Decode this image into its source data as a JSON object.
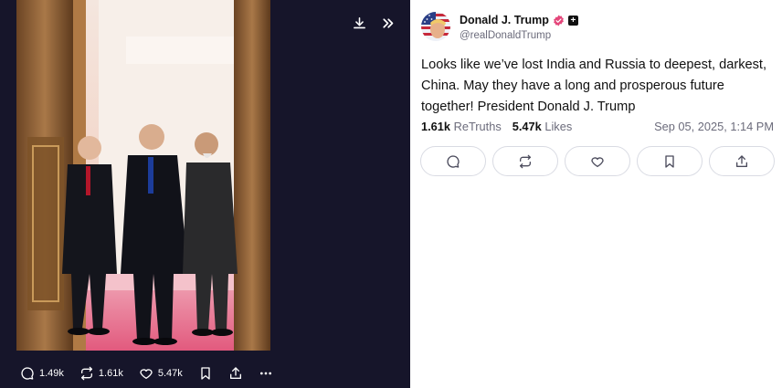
{
  "media": {
    "download_icon": "download-icon",
    "expand_icon": "chevrons-right-icon",
    "actions": {
      "replies_count": "1.49k",
      "retruths_count": "1.61k",
      "likes_count": "5.47k"
    }
  },
  "post": {
    "author_name": "Donald J. Trump",
    "author_handle": "@realDonaldTrump",
    "text": "Looks like we’ve lost India and Russia to deepest, darkest, China. May they have a long and prosperous future together! President Donald J. Trump",
    "retruths_value": "1.61k",
    "retruths_label": "ReTruths",
    "likes_value": "5.47k",
    "likes_label": "Likes",
    "timestamp": "Sep 05, 2025, 1:14 PM"
  },
  "colors": {
    "media_background": "#16152a",
    "verified_badge": "#e4467a",
    "muted_text": "#6b6b7b",
    "pill_border": "#d9dbe3"
  }
}
